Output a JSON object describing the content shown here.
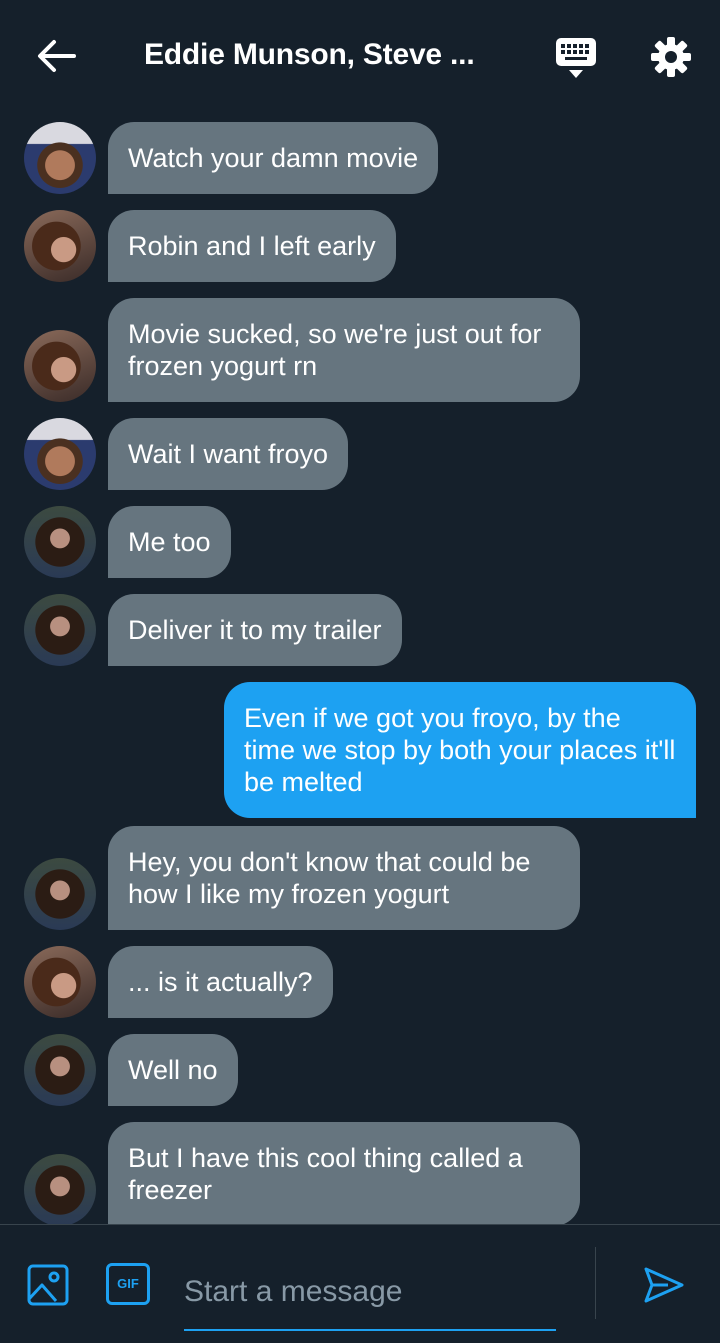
{
  "header": {
    "title": "Eddie Munson, Steve ...",
    "icons": [
      "back-arrow-icon",
      "keyboard-icon",
      "gear-icon"
    ]
  },
  "messages": [
    {
      "sender": "steve",
      "text": "Watch your damn movie"
    },
    {
      "sender": "robin",
      "text": "Robin and I left early"
    },
    {
      "sender": "robin",
      "text": "Movie sucked, so we're just out for frozen yogurt rn"
    },
    {
      "sender": "steve",
      "text": "Wait I want froyo"
    },
    {
      "sender": "eddie",
      "text": "Me too"
    },
    {
      "sender": "eddie",
      "text": "Deliver it to my trailer"
    },
    {
      "sender": "me",
      "text": "Even if we got you froyo, by the time we stop by both your places it'll be melted"
    },
    {
      "sender": "eddie",
      "text": "Hey, you don't know that could be how I like my frozen yogurt"
    },
    {
      "sender": "robin",
      "text": "... is it actually?"
    },
    {
      "sender": "eddie",
      "text": "Well no"
    },
    {
      "sender": "eddie",
      "text": "But I have this cool thing called a freezer"
    }
  ],
  "composer": {
    "placeholder": "Start a message",
    "gif_label": "GIF",
    "icons": [
      "image-icon",
      "gif-icon",
      "send-icon"
    ]
  },
  "colors": {
    "background": "#15202b",
    "incoming_bubble": "#66757f",
    "outgoing_bubble": "#1da1f2",
    "accent": "#1da1f2"
  }
}
